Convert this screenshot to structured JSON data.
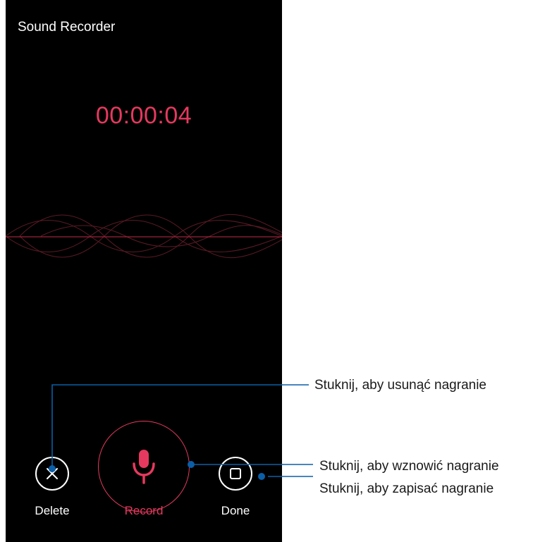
{
  "app": {
    "title": "Sound Recorder"
  },
  "recorder": {
    "elapsed": "00:00:04"
  },
  "controls": {
    "delete_label": "Delete",
    "record_label": "Record",
    "done_label": "Done"
  },
  "callouts": {
    "delete": "Stuknij, aby usunąć nagranie",
    "resume": "Stuknij, aby wznowić nagranie",
    "save": "Stuknij, aby zapisać nagranie"
  },
  "colors": {
    "accent": "#e6395f",
    "background": "#000000",
    "callout_line": "#0b5fa8"
  },
  "icons": {
    "delete": "close-icon",
    "record": "microphone-icon",
    "done": "stop-icon"
  }
}
